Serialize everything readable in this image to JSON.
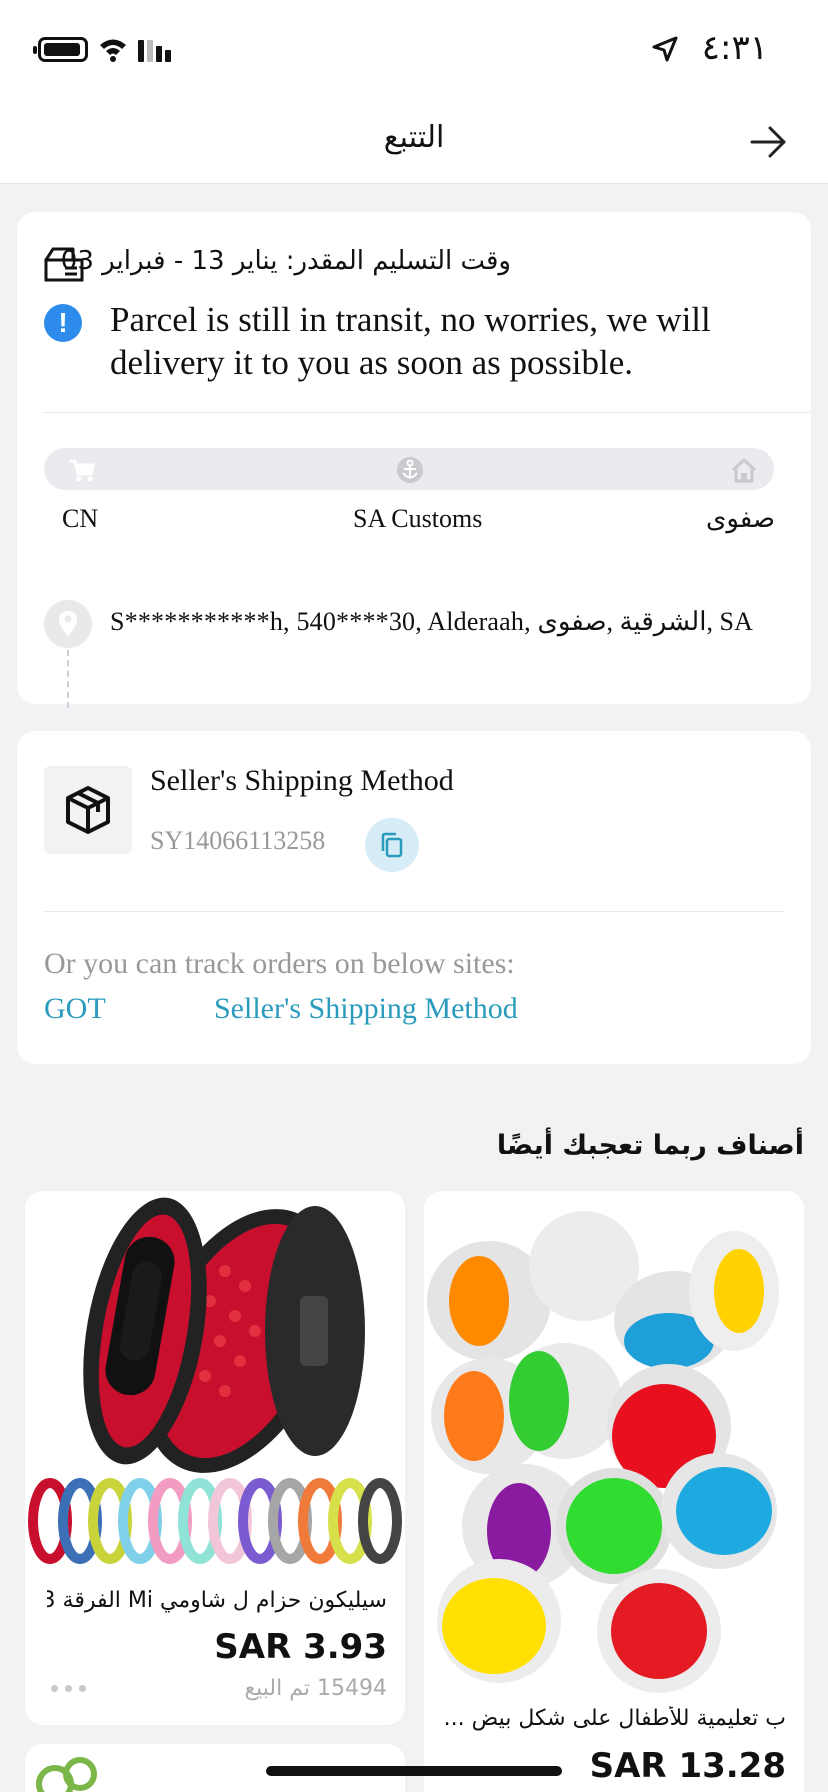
{
  "status_bar": {
    "time": "٤:٣١"
  },
  "header": {
    "title": "التتبع"
  },
  "tracking": {
    "eta": "وقت التسليم المقدر: يناير 13 - فبراير 03",
    "message": "Parcel is still in transit, no worries, we will delivery it to you as soon as possible.",
    "stages": [
      "CN",
      "SA Customs",
      "صفوى"
    ],
    "address": "S***********h,  540****30,  Alderaah,  الشرقية  ,صفوى,  SA"
  },
  "shipping": {
    "method_title": "Seller's Shipping Method",
    "tracking_number": "SY14066113258",
    "other_sites_text": "Or you can track orders on below sites:",
    "links": [
      "GOT",
      "Seller's Shipping Method"
    ]
  },
  "recommendations": {
    "title": "أصناف ربما تعجبك أيضًا",
    "products": [
      {
        "title": "سيليكون حزام ل شاومي Mi الفرقة 3...",
        "price": "SAR 3.93",
        "sold": "15494 تم البيع"
      },
      {
        "title": "ب تعليمية للأطفال على شكل بيض ...",
        "price": "SAR 13.28"
      }
    ]
  },
  "icons": [
    "battery-icon",
    "wifi-icon",
    "signal-icon",
    "location-arrow-icon",
    "back-arrow-icon",
    "truck-icon",
    "info-icon",
    "cart-icon",
    "anchor-icon",
    "home-icon",
    "location-pin-icon",
    "box-icon",
    "copy-icon",
    "more-icon"
  ],
  "colors": {
    "accent_link": "#2a9bbd",
    "info_blue": "#2d8ceb",
    "copy_bg": "#d6ecf7"
  }
}
